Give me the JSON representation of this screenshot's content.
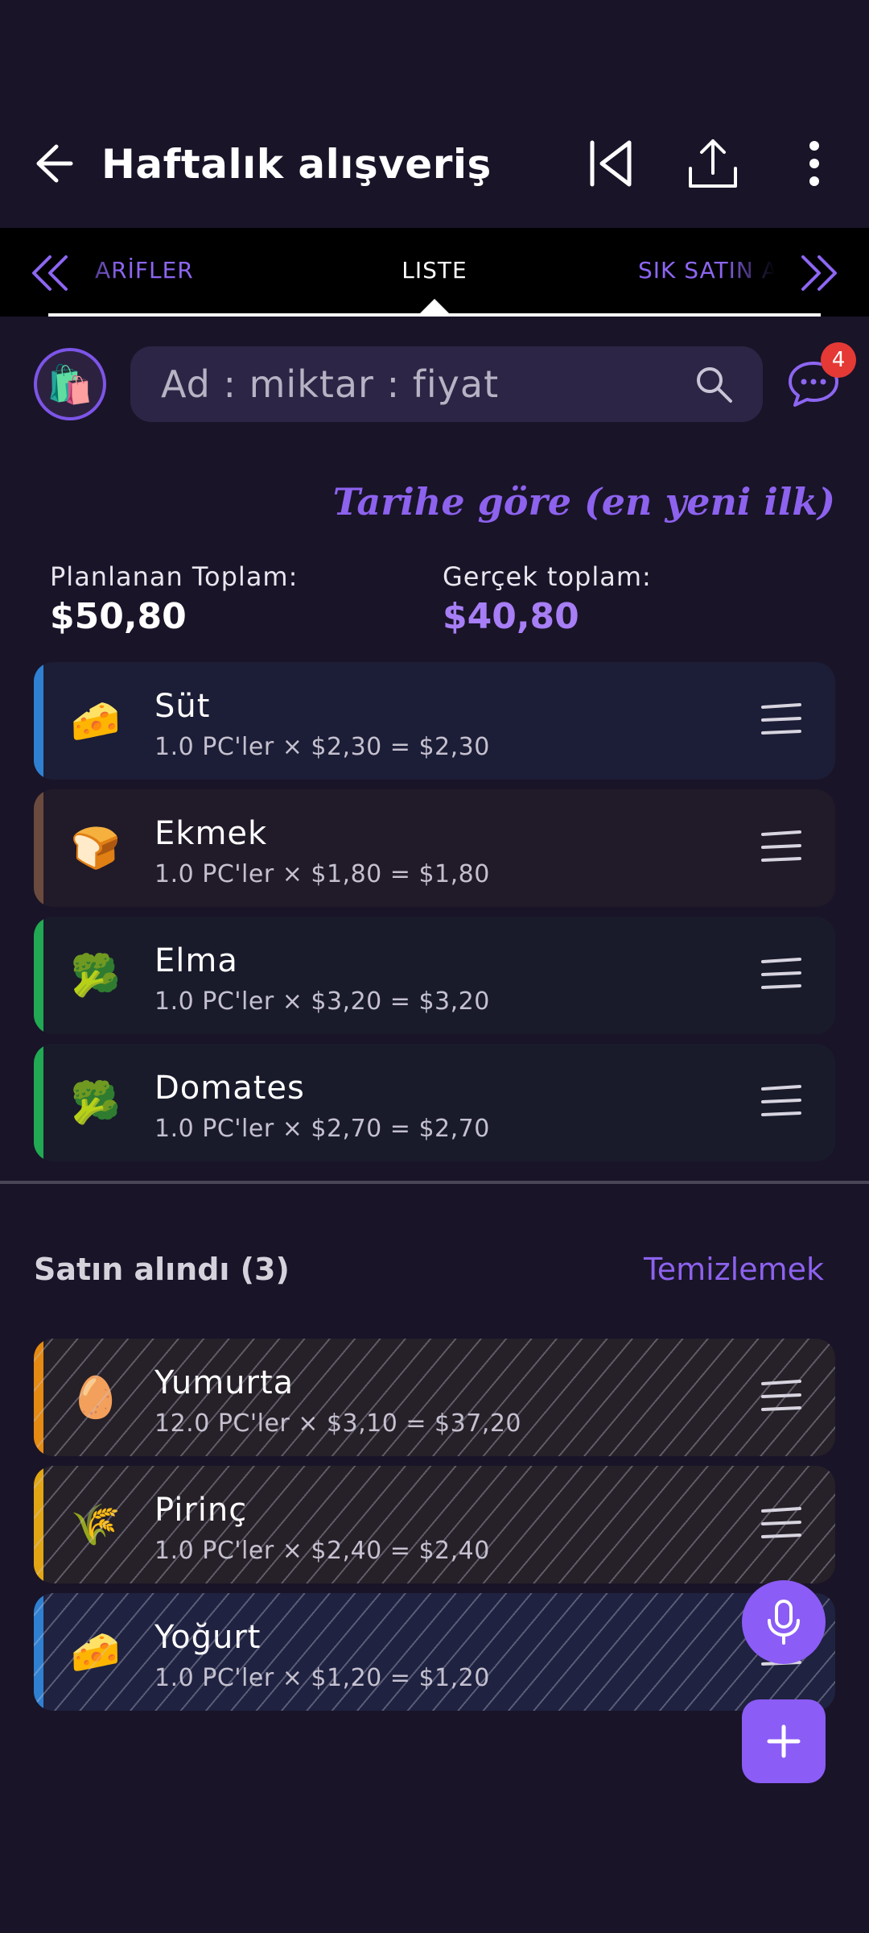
{
  "header": {
    "title": "Haftalık alışveriş"
  },
  "tabs": {
    "left": "ARİFLER",
    "left_visible": "ARİFLER",
    "center": "LISTE",
    "right": "SIK SATIN A"
  },
  "search": {
    "placeholder": "Ad : miktar : fiyat"
  },
  "chat": {
    "badge_count": "4"
  },
  "sort": {
    "label": "Tarihe göre (en yeni ilk)"
  },
  "totals": {
    "planned_label": "Planlanan Toplam:",
    "planned_value": "$50,80",
    "actual_label": "Gerçek toplam:",
    "actual_value": "$40,80"
  },
  "items": [
    {
      "name": "Süt",
      "detail": "1.0 PC'ler × $2,30 = $2,30",
      "emoji": "🧀",
      "stripe": "#2f80d1",
      "bg": "#1c1d36"
    },
    {
      "name": "Ekmek",
      "detail": "1.0 PC'ler × $1,80 = $1,80",
      "emoji": "🍞",
      "stripe": "#6b4b3e",
      "bg": "#211a29"
    },
    {
      "name": "Elma",
      "detail": "1.0 PC'ler × $3,20 = $3,20",
      "emoji": "🥦",
      "stripe": "#21a953",
      "bg": "#191b2b"
    },
    {
      "name": "Domates",
      "detail": "1.0 PC'ler × $2,70 = $2,70",
      "emoji": "🥦",
      "stripe": "#21a953",
      "bg": "#191b2b"
    }
  ],
  "purchased": {
    "title": "Satın alındı (3)",
    "clear_label": "Temizlemek",
    "items": [
      {
        "name": "Yumurta",
        "detail": "12.0 PC'ler × $3,10 = $37,20",
        "emoji": "🥚",
        "stripe": "#e58a12",
        "bg": "#262028"
      },
      {
        "name": "Pirinç",
        "detail": "1.0 PC'ler × $2,40 = $2,40",
        "emoji": "🌾",
        "stripe": "#e2a614",
        "bg": "#262028"
      },
      {
        "name": "Yoğurt",
        "detail": "1.0 PC'ler × $1,20 = $1,20",
        "emoji": "🧀",
        "stripe": "#2f80d1",
        "bg": "#1f2240"
      }
    ]
  },
  "colors": {
    "accent": "#8b5cf6",
    "background": "#191428"
  }
}
